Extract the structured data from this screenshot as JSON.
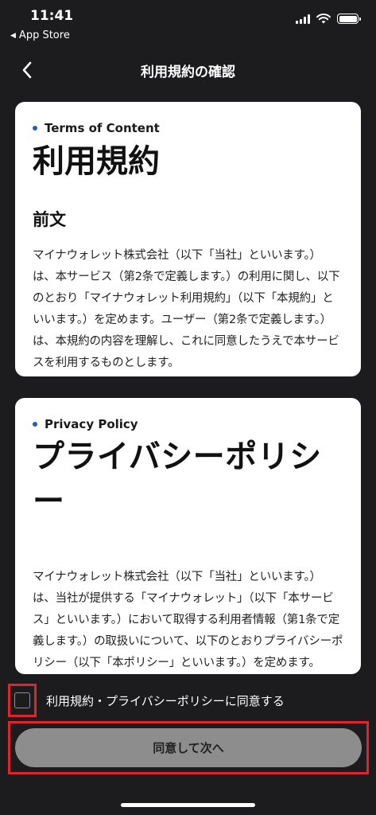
{
  "status_bar": {
    "time": "11:41",
    "back_app": "App Store",
    "back_triangle": "◀"
  },
  "nav": {
    "title": "利用規約の確認"
  },
  "terms_card": {
    "kicker": "Terms of Content",
    "heading": "利用規約",
    "subheading": "前文",
    "body": "マイナウォレット株式会社（以下「当社」といいます。）は、本サービス（第2条で定義します。）の利用に関し、以下のとおり「マイナウォレット利用規約」（以下「本規約」といいます。）を定めます。ユーザー（第2条で定義します。）は、本規約の内容を理解し、これに同意したうえで本サービスを利用するものとします。"
  },
  "privacy_card": {
    "kicker": "Privacy Policy",
    "heading": "プライバシーポリシー",
    "body": "マイナウォレット株式会社（以下「当社」といいます。）は、当社が提供する「マイナウォレット」（以下「本サービス」といいます。）において取得する利用者情報（第1条で定義します。）の取扱いについて、以下のとおりプライバシーポリシー（以下「本ポリシー」といいます。）を定めます。"
  },
  "consent": {
    "label": "利用規約・プライバシーポリシーに同意する",
    "checked": false
  },
  "cta": {
    "label": "同意して次へ"
  },
  "colors": {
    "background": "#1c1c1e",
    "accent_dot": "#1f5fbf",
    "highlight_border": "#e0242e",
    "button_disabled": "#8d8d8d"
  }
}
